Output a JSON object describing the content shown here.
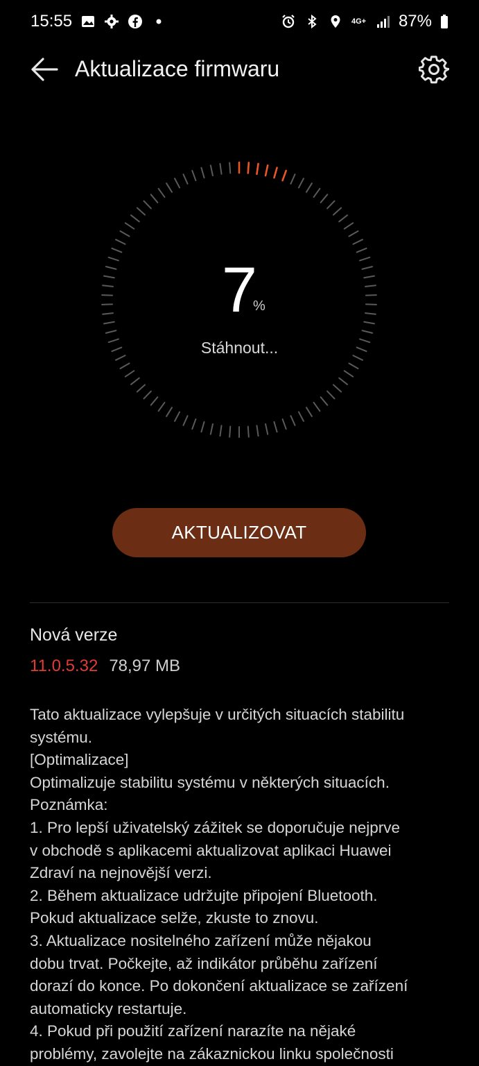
{
  "statusbar": {
    "time": "15:55",
    "battery": "87%",
    "network": "4G+",
    "left_icons": [
      "image-icon",
      "settings-icon",
      "facebook-icon",
      "dot-icon"
    ],
    "right_icons": [
      "alarm-icon",
      "bluetooth-icon",
      "location-icon",
      "signal-icon",
      "battery-icon"
    ]
  },
  "header": {
    "title": "Aktualizace firmwaru"
  },
  "progress": {
    "value": "7",
    "unit": "%",
    "fraction": 0.07,
    "status": "Stáhnout..."
  },
  "colors": {
    "accent": "#e8572a",
    "button_bg": "#6b2e14",
    "version": "#e03c32"
  },
  "actions": {
    "update_label": "AKTUALIZOVAT"
  },
  "version": {
    "label": "Nová verze",
    "number": "11.0.5.32",
    "size": "78,97 MB"
  },
  "notes": [
    "Tato aktualizace vylepšuje v určitých situacích stabilitu",
    "systému.",
    "[Optimalizace]",
    "Optimalizuje stabilitu systému v některých situacích.",
    "Poznámka:",
    "1. Pro lepší uživatelský zážitek se doporučuje nejprve",
    "v obchodě s aplikacemi aktualizovat aplikaci Huawei",
    "Zdraví na nejnovější verzi.",
    "2. Během aktualizace udržujte připojení Bluetooth.",
    "Pokud aktualizace selže, zkuste to znovu.",
    "3. Aktualizace nositelného zařízení může nějakou",
    "dobu trvat. Počkejte, až indikátor průběhu zařízení",
    "dorazí do konce. Po dokončení aktualizace se zařízení",
    "automaticky restartuje.",
    "4. Pokud při použití zařízení narazíte na nějaké",
    "problémy, zavolejte na zákaznickou linku společnosti"
  ]
}
